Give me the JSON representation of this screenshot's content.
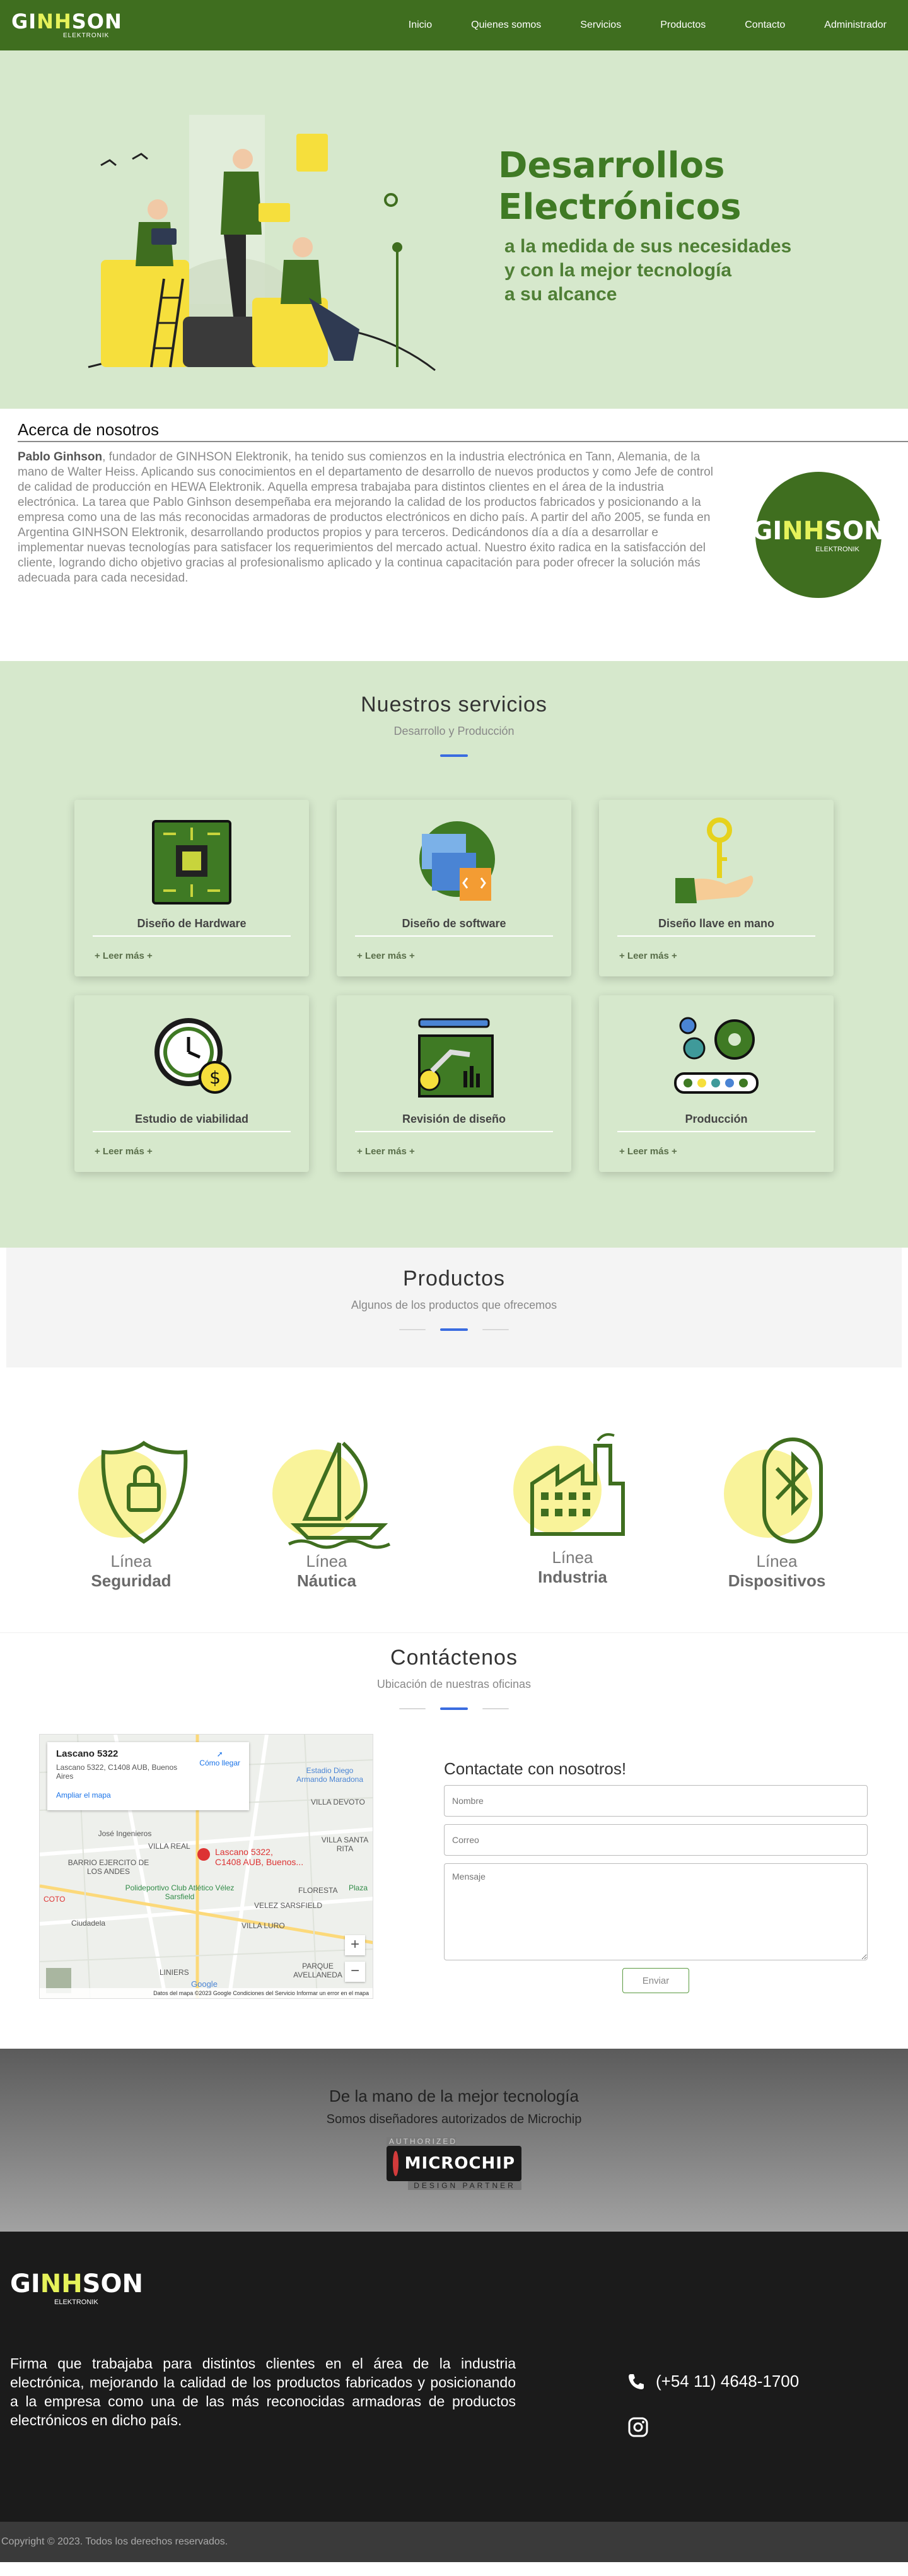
{
  "brand": {
    "name_pre": "GI",
    "name_h": "NH",
    "name_post": "SON",
    "sub": "ELEKTRONIK"
  },
  "nav": {
    "items": [
      "Inicio",
      "Quienes somos",
      "Servicios",
      "Productos",
      "Contacto",
      "Administrador"
    ]
  },
  "hero": {
    "title_l1": "Desarrollos",
    "title_l2": "Electrónicos",
    "subtitle": "a la medida de sus necesidades\ny con la mejor tecnología\n a su alcance"
  },
  "about": {
    "title": "Acerca de nosotros",
    "lead": "Pablo Ginhson",
    "body": ", fundador de GINHSON Elektronik, ha tenido sus comienzos en la industria electrónica en Tann, Alemania, de la mano de Walter Heiss. Aplicando sus conocimientos en el departamento de desarrollo de nuevos productos y como Jefe de control de calidad de producción en HEWA Elektronik. Aquella empresa trabajaba para distintos clientes en el área de la industria electrónica. La tarea que Pablo Ginhson desempeñaba era mejorando la calidad de los productos fabricados y posicionando a la empresa como una de las más reconocidas armadoras de productos electrónicos en dicho país. A partir del año 2005, se funda en Argentina GINHSON Elektronik, desarrollando productos propios y para terceros. Dedicándonos día a día a desarrollar e implementar nuevas tecnologías para satisfacer los requerimientos del mercado actual. Nuestro éxito radica en la satisfacción del cliente, logrando dicho objetivo gracias al profesionalismo aplicado y la continua capacitación para poder ofrecer la solución más adecuada para cada necesidad."
  },
  "services": {
    "title": "Nuestros servicios",
    "subtitle": "Desarrollo y Producción",
    "more_label": "+ Leer más +",
    "cards": [
      {
        "title": "Diseño de Hardware",
        "icon": "circuit-board-icon"
      },
      {
        "title": "Diseño de software",
        "icon": "software-icon"
      },
      {
        "title": "Diseño llave en mano",
        "icon": "key-hand-icon"
      },
      {
        "title": "Estudio de viabilidad",
        "icon": "clock-money-icon"
      },
      {
        "title": "Revisión de diseño",
        "icon": "robot-arm-icon"
      },
      {
        "title": "Producción",
        "icon": "gears-conveyor-icon"
      }
    ]
  },
  "products": {
    "title": "Productos",
    "subtitle": "Algunos de los productos que ofrecemos",
    "items": [
      {
        "line": "Línea",
        "name": "Seguridad",
        "icon": "shield-lock-icon"
      },
      {
        "line": "Línea",
        "name": "Náutica",
        "icon": "sailboat-icon"
      },
      {
        "line": "Línea",
        "name": "Industria",
        "icon": "factory-icon"
      },
      {
        "line": "Línea",
        "name": "Dispositivos",
        "icon": "bluetooth-icon"
      }
    ]
  },
  "contact": {
    "title": "Contáctenos",
    "subtitle": "Ubicación de nuestras oficinas",
    "map": {
      "place": "Lascano 5322",
      "address": "Lascano 5322, C1408 AUB, Buenos Aires",
      "directions": "Cómo llegar",
      "larger_map": "Ampliar el mapa",
      "pin_l1": "Lascano 5322,",
      "pin_l2": "C1408 AUB, Buenos...",
      "labels": [
        "Estadio Diego Armando Maradona",
        "BARRIO EJERCITO DE LOS ANDES",
        "Polideportivo Club Atlético Vélez Sarsfield",
        "FLORESTA",
        "VILLA SANTA RITA",
        "VILLA DEVOTO",
        "Ciudadela",
        "PARQUE AVELLANEDA",
        "LINIERS",
        "COTO",
        "José Ingenieros",
        "VILLA REAL",
        "VELEZ SARSFIELD",
        "VILLA LURO",
        "Plaza"
      ],
      "footer": "Datos del mapa ©2023 Google   Condiciones del Servicio   Informar un error en el mapa",
      "google": "Google"
    },
    "form": {
      "title": "Contactate con nosotros!",
      "name_placeholder": "Nombre",
      "email_placeholder": "Correo",
      "message_placeholder": "Mensaje",
      "submit": "Enviar"
    }
  },
  "partner": {
    "title": "De la mano de la mejor tecnología",
    "subtitle": "Somos diseñadores autorizados de Microchip",
    "badge_top": "AUTHORIZED",
    "badge_name": "MICROCHIP",
    "badge_bottom": "DESIGN PARTNER"
  },
  "footer": {
    "text": "Firma que trabajaba para distintos clientes en el área de la industria electrónica, mejorando la calidad de los productos fabricados y posicionando a la empresa como una de las más reconocidas armadoras de productos electrónicos en dicho país.",
    "phone": "(+54 11) 4648-1700",
    "copyright": "Copyright © 2023. Todos los derechos reservados."
  },
  "colors": {
    "nav": "#3f6e1f",
    "hero_bg": "#d6e8cc",
    "accent_bar": "#3a6ce0",
    "yellow": "#f9f39a"
  }
}
